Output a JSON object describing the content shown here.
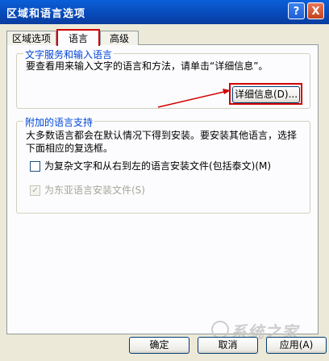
{
  "window": {
    "title": "区域和语言选项",
    "help_glyph": "?",
    "close_glyph": "X"
  },
  "tabs": [
    {
      "label": "区域选项"
    },
    {
      "label": "语言"
    },
    {
      "label": "高级"
    }
  ],
  "text_services": {
    "group_label": "文字服务和输入语言",
    "description": "要查看用来输入文字的语言和方法，请单击“详细信息”。",
    "details_button": "详细信息(D)..."
  },
  "supplemental": {
    "group_label": "附加的语言支持",
    "description_line1": "大多数语言都会在默认情况下得到安装。要安装其他语言，选择",
    "description_line2": "下面相应的复选框。",
    "complex_script_label": "为复杂文字和从右到左的语言安装文件(包括泰文)(M)",
    "complex_script_checked": false,
    "east_asian_label": "为东亚语言安装文件(S)",
    "east_asian_checked": true,
    "east_asian_check_glyph": "✓"
  },
  "buttons": {
    "ok": "确定",
    "cancel": "取消",
    "apply": "应用(A)"
  },
  "watermark": "系统之家",
  "annotation_color": "#d10000"
}
